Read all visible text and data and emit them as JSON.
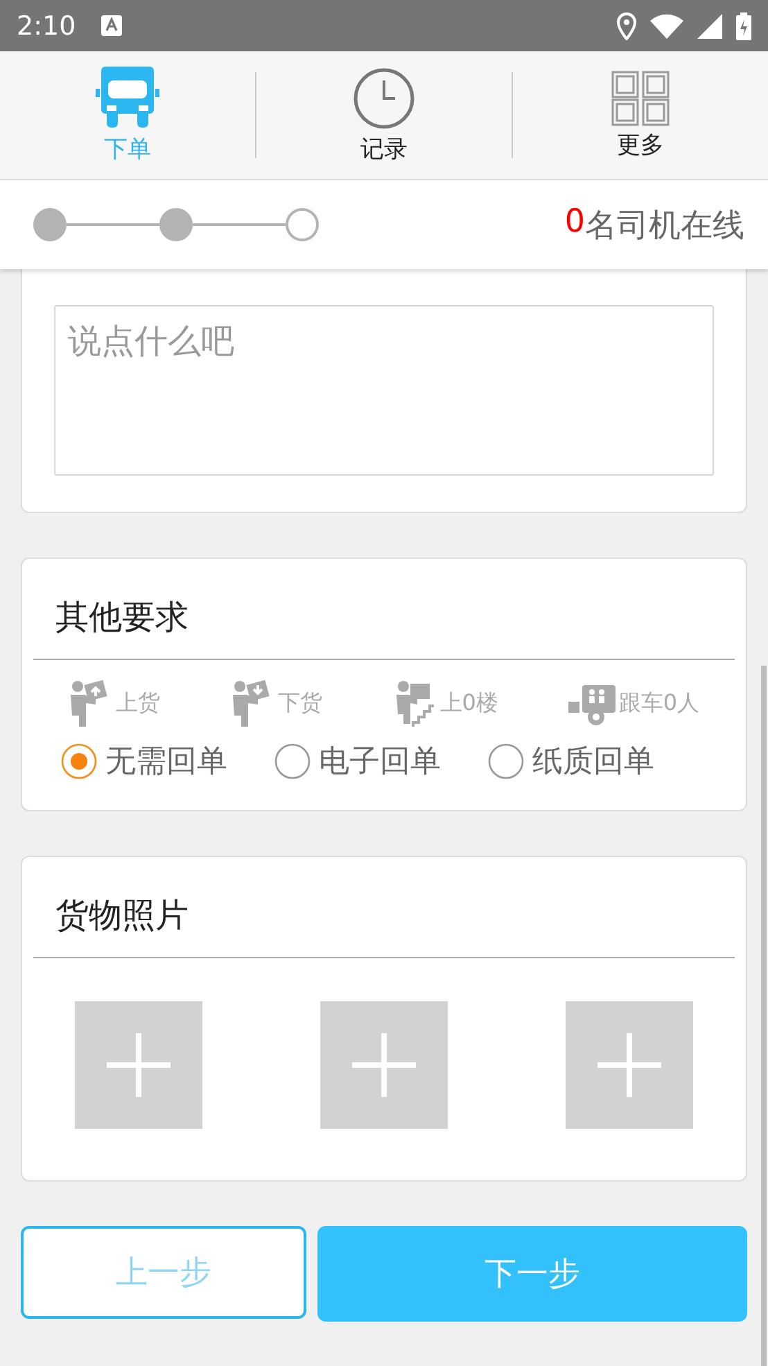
{
  "status_bar": {
    "time": "2:10"
  },
  "nav_tabs": [
    {
      "label": "下单",
      "kind": "truck",
      "selected": true
    },
    {
      "label": "记录",
      "kind": "clock",
      "selected": false
    },
    {
      "label": "更多",
      "kind": "grid",
      "selected": false
    }
  ],
  "progress": {
    "steps": [
      {
        "done": true
      },
      {
        "done": true
      },
      {
        "done": false
      }
    ],
    "online_count": "0",
    "online_label": "名司机在线"
  },
  "message_card": {
    "placeholder": "说点什么吧"
  },
  "other_requirements": {
    "title": "其他要求",
    "services": [
      {
        "kind": "load",
        "label": "上货",
        "selected": false
      },
      {
        "kind": "unload",
        "label": "下货",
        "selected": false
      },
      {
        "kind": "stairs",
        "label": "上0楼",
        "selected": false
      },
      {
        "kind": "escort",
        "label": "跟车0人",
        "selected": false
      }
    ],
    "receipt_options": [
      {
        "label": "无需回单",
        "selected": true
      },
      {
        "label": "电子回单",
        "selected": false
      },
      {
        "label": "纸质回单",
        "selected": false
      }
    ]
  },
  "cargo_photos": {
    "title": "货物照片",
    "slots": [
      {
        "kind": "add"
      },
      {
        "kind": "add"
      },
      {
        "kind": "add"
      }
    ]
  },
  "buttons": {
    "previous": "上一步",
    "next": "下一步"
  }
}
